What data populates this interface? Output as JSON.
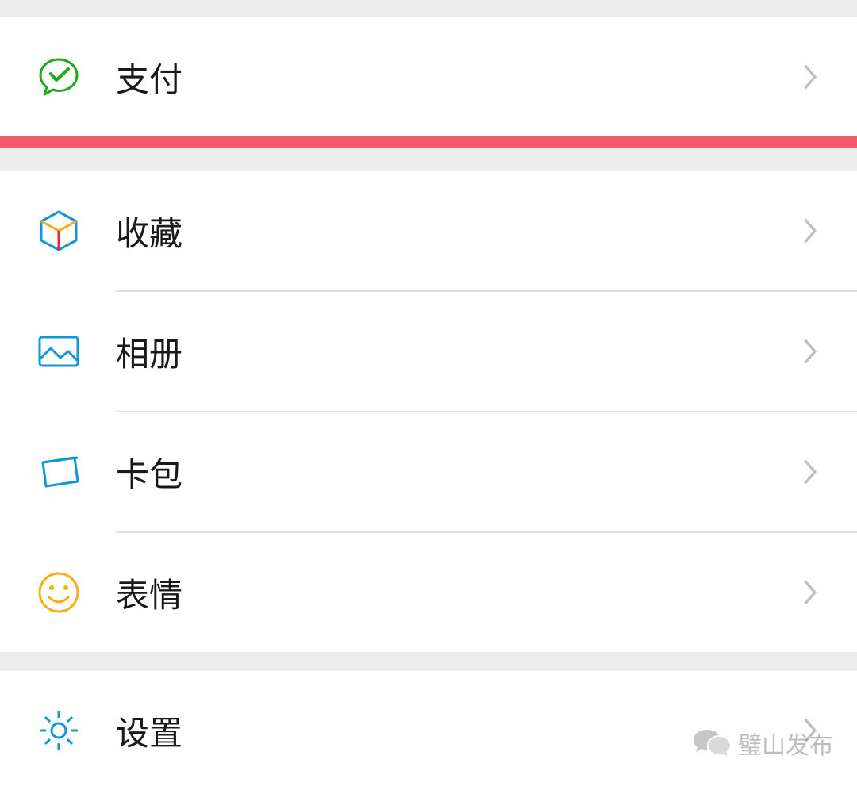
{
  "groups": [
    {
      "items": [
        {
          "id": "pay",
          "label": "支付",
          "icon": "wechat-pay-icon",
          "highlight_below": true
        }
      ]
    },
    {
      "items": [
        {
          "id": "favorites",
          "label": "收藏",
          "icon": "cube-icon"
        },
        {
          "id": "album",
          "label": "相册",
          "icon": "photo-icon"
        },
        {
          "id": "cards",
          "label": "卡包",
          "icon": "wallet-icon"
        },
        {
          "id": "emoji",
          "label": "表情",
          "icon": "smiley-icon"
        }
      ]
    },
    {
      "items": [
        {
          "id": "settings",
          "label": "设置",
          "icon": "gear-icon"
        }
      ]
    }
  ],
  "watermark": {
    "text": "璧山发布"
  }
}
